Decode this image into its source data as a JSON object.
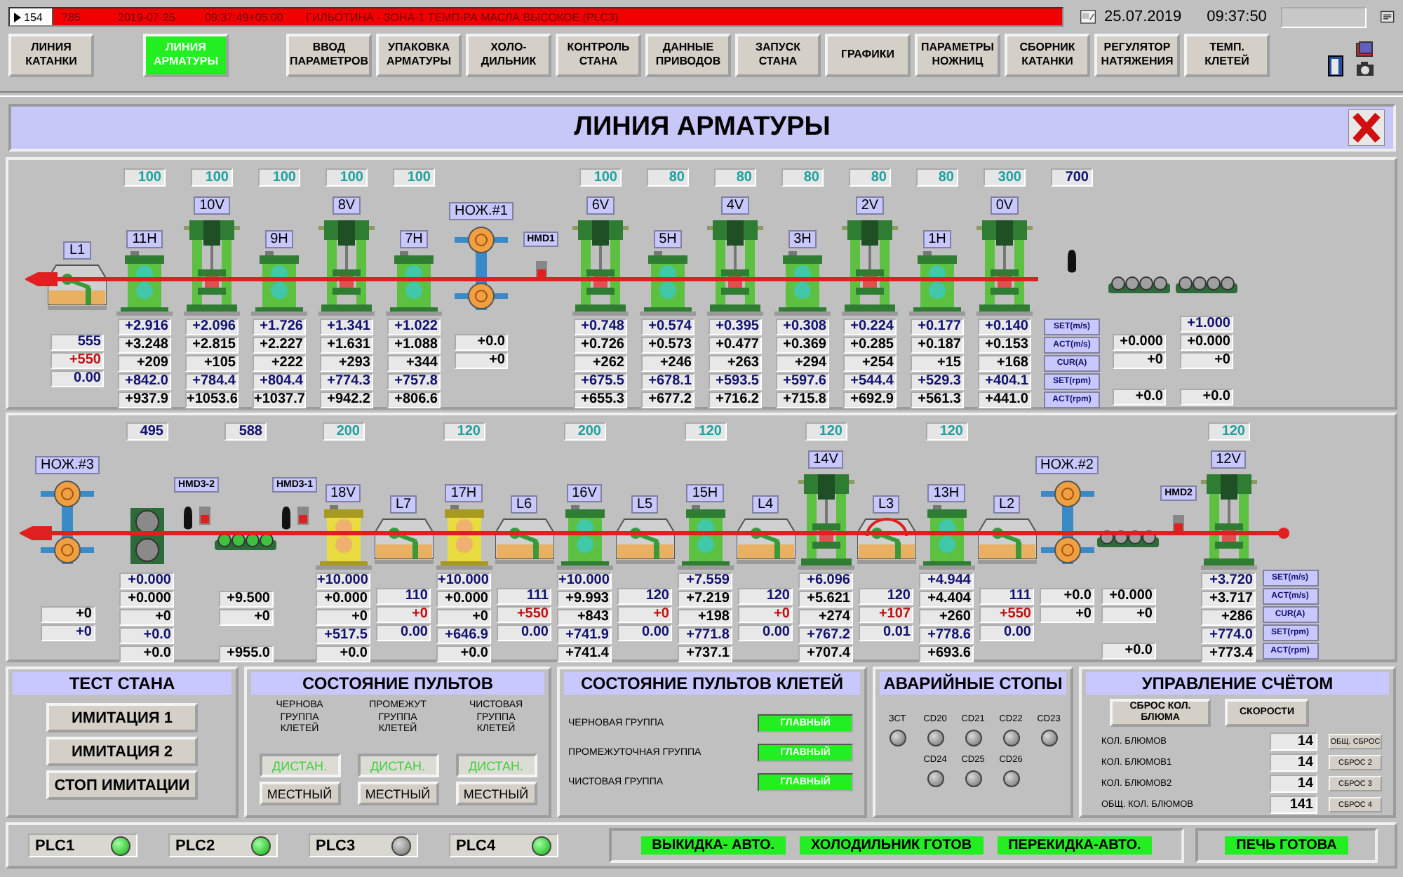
{
  "alarm_bar": {
    "count": "154",
    "code": "785",
    "date": "2019-07-25",
    "time": "09:37:49+05:00",
    "message": "ГИЛЬОТИНА - ЗОНА-1 ТЕМП-РА МАСЛА ВЫСОКОЕ (PLC3)"
  },
  "clock": {
    "date": "25.07.2019",
    "time": "09:37:50"
  },
  "nav": [
    {
      "label": "ЛИНИЯ\nКАТАНКИ",
      "selected": false
    },
    {
      "label": "ЛИНИЯ\nАРМАТУРЫ",
      "selected": true
    },
    {
      "label": "ВВОД\nПАРАМЕТРОВ",
      "selected": false
    },
    {
      "label": "УПАКОВКА\nАРМАТУРЫ",
      "selected": false
    },
    {
      "label": "ХОЛО-\nДИЛЬНИК",
      "selected": false
    },
    {
      "label": "КОНТРОЛЬ\nСТАНА",
      "selected": false
    },
    {
      "label": "ДАННЫЕ\nПРИВОДОВ",
      "selected": false
    },
    {
      "label": "ЗАПУСК\nСТАНА",
      "selected": false
    },
    {
      "label": "ГРАФИКИ",
      "selected": false
    },
    {
      "label": "ПАРАМЕТРЫ\nНОЖНИЦ",
      "selected": false
    },
    {
      "label": "СБОРНИК\nКАТАНКИ",
      "selected": false
    },
    {
      "label": "РЕГУЛЯТОР\nНАТЯЖЕНИЯ",
      "selected": false
    },
    {
      "label": "ТЕМП.\nКЛЕТЕЙ",
      "selected": false
    }
  ],
  "title": "ЛИНИЯ АРМАТУРЫ",
  "upper_line": {
    "columns": [
      {
        "kind": "looper",
        "label": "L1",
        "raised": false,
        "readings": {
          "act_speed": "555",
          "current": "+550",
          "set_rpm": "0.00"
        }
      },
      {
        "kind": "hstand",
        "label": "11H",
        "setpoint": "100",
        "running": true,
        "readings": {
          "set_speed": "+2.916",
          "act_speed": "+3.248",
          "current": "+209",
          "set_rpm": "+842.0",
          "act_rpm": "+937.9"
        }
      },
      {
        "kind": "vstand",
        "label": "10V",
        "setpoint": "100",
        "running": true,
        "readings": {
          "set_speed": "+2.096",
          "act_speed": "+2.815",
          "current": "+105",
          "set_rpm": "+784.4",
          "act_rpm": "+1053.6"
        }
      },
      {
        "kind": "hstand",
        "label": "9H",
        "setpoint": "100",
        "running": true,
        "readings": {
          "set_speed": "+1.726",
          "act_speed": "+2.227",
          "current": "+222",
          "set_rpm": "+804.4",
          "act_rpm": "+1037.7"
        }
      },
      {
        "kind": "vstand",
        "label": "8V",
        "setpoint": "100",
        "running": true,
        "readings": {
          "set_speed": "+1.341",
          "act_speed": "+1.631",
          "current": "+293",
          "set_rpm": "+774.3",
          "act_rpm": "+942.2"
        }
      },
      {
        "kind": "hstand",
        "label": "7H",
        "setpoint": "100",
        "running": true,
        "readings": {
          "set_speed": "+1.022",
          "act_speed": "+1.088",
          "current": "+344",
          "set_rpm": "+757.8",
          "act_rpm": "+806.6"
        }
      },
      {
        "kind": "shear",
        "label": "НОЖ.#1",
        "readings": {
          "act_speed": "+0.0",
          "current": "+0"
        }
      },
      {
        "kind": "sensor",
        "label": "HMD1"
      },
      {
        "kind": "vstand",
        "label": "6V",
        "setpoint": "100",
        "running": true,
        "readings": {
          "set_speed": "+0.748",
          "act_speed": "+0.726",
          "current": "+262",
          "set_rpm": "+675.5",
          "act_rpm": "+655.3"
        }
      },
      {
        "kind": "hstand",
        "label": "5H",
        "setpoint": "80",
        "running": true,
        "readings": {
          "set_speed": "+0.574",
          "act_speed": "+0.573",
          "current": "+246",
          "set_rpm": "+678.1",
          "act_rpm": "+677.2"
        }
      },
      {
        "kind": "vstand",
        "label": "4V",
        "setpoint": "80",
        "running": true,
        "readings": {
          "set_speed": "+0.395",
          "act_speed": "+0.477",
          "current": "+263",
          "set_rpm": "+593.5",
          "act_rpm": "+716.2"
        }
      },
      {
        "kind": "hstand",
        "label": "3H",
        "setpoint": "80",
        "running": true,
        "readings": {
          "set_speed": "+0.308",
          "act_speed": "+0.369",
          "current": "+294",
          "set_rpm": "+597.6",
          "act_rpm": "+715.8"
        }
      },
      {
        "kind": "vstand",
        "label": "2V",
        "setpoint": "80",
        "running": true,
        "readings": {
          "set_speed": "+0.224",
          "act_speed": "+0.285",
          "current": "+254",
          "set_rpm": "+544.4",
          "act_rpm": "+692.9"
        }
      },
      {
        "kind": "hstand",
        "label": "1H",
        "setpoint": "80",
        "running": true,
        "readings": {
          "set_speed": "+0.177",
          "act_speed": "+0.187",
          "current": "+15",
          "set_rpm": "+529.3",
          "act_rpm": "+561.3"
        }
      },
      {
        "kind": "vstand",
        "label": "0V",
        "setpoint": "300",
        "running": true,
        "readings": {
          "set_speed": "+0.140",
          "act_speed": "+0.153",
          "current": "+168",
          "set_rpm": "+404.1",
          "act_rpm": "+441.0"
        }
      },
      {
        "kind": "probe",
        "setpoint": "700",
        "row_labels": [
          "SET(m/s)",
          "ACT(m/s)",
          "CUR(A)",
          "SET(rpm)",
          "ACT(rpm)"
        ]
      },
      {
        "kind": "rollers",
        "active": false,
        "readings": {
          "act_speed": "+0.000",
          "current": "+0",
          "act_rpm": "+0.0"
        }
      },
      {
        "kind": "rollers",
        "active": false,
        "readings": {
          "set_speed": "+1.000",
          "act_speed": "+0.000",
          "current": "+0",
          "act_rpm": "+0.0"
        }
      }
    ]
  },
  "lower_line": {
    "columns": [
      {
        "kind": "shear",
        "label": "НОЖ.#3",
        "readings": {
          "current": "+0",
          "set_rpm": "+0"
        }
      },
      {
        "kind": "pinch",
        "setpoint": "495",
        "readings": {
          "set_speed": "+0.000",
          "act_speed": "+0.000",
          "current": "+0",
          "set_rpm": "+0.0",
          "act_rpm": "+0.0"
        }
      },
      {
        "kind": "probe_sensor",
        "label": "HMD3-2"
      },
      {
        "kind": "rollers",
        "setpoint": "588",
        "active": true,
        "readings": {
          "act_speed": "+9.500",
          "current": "+0",
          "act_rpm": "+955.0"
        }
      },
      {
        "kind": "probe_sensor",
        "label": "HMD3-1"
      },
      {
        "kind": "hstand",
        "label": "18V",
        "setpoint": "200",
        "running": false,
        "readings": {
          "set_speed": "+10.000",
          "act_speed": "+0.000",
          "current": "+0",
          "set_rpm": "+517.5",
          "act_rpm": "+0.0"
        }
      },
      {
        "kind": "looper",
        "label": "L7",
        "raised": false,
        "readings": {
          "act_speed": "110",
          "current": "+0",
          "set_rpm": "0.00"
        }
      },
      {
        "kind": "hstand",
        "label": "17H",
        "setpoint": "120",
        "running": false,
        "readings": {
          "set_speed": "+10.000",
          "act_speed": "+0.000",
          "current": "+0",
          "set_rpm": "+646.9",
          "act_rpm": "+0.0"
        }
      },
      {
        "kind": "looper",
        "label": "L6",
        "raised": false,
        "readings": {
          "act_speed": "111",
          "current": "+550",
          "set_rpm": "0.00"
        }
      },
      {
        "kind": "hstand",
        "label": "16V",
        "setpoint": "200",
        "running": true,
        "readings": {
          "set_speed": "+10.000",
          "act_speed": "+9.993",
          "current": "+843",
          "set_rpm": "+741.9",
          "act_rpm": "+741.4"
        }
      },
      {
        "kind": "looper",
        "label": "L5",
        "raised": false,
        "readings": {
          "act_speed": "120",
          "current": "+0",
          "set_rpm": "0.00"
        }
      },
      {
        "kind": "hstand",
        "label": "15H",
        "setpoint": "120",
        "running": true,
        "readings": {
          "set_speed": "+7.559",
          "act_speed": "+7.219",
          "current": "+198",
          "set_rpm": "+771.8",
          "act_rpm": "+737.1"
        }
      },
      {
        "kind": "looper",
        "label": "L4",
        "raised": false,
        "readings": {
          "act_speed": "120",
          "current": "+0",
          "set_rpm": "0.00"
        }
      },
      {
        "kind": "vstand",
        "label": "14V",
        "setpoint": "120",
        "running": true,
        "readings": {
          "set_speed": "+6.096",
          "act_speed": "+5.621",
          "current": "+274",
          "set_rpm": "+767.2",
          "act_rpm": "+707.4"
        }
      },
      {
        "kind": "looper",
        "label": "L3",
        "raised": true,
        "readings": {
          "act_speed": "120",
          "current": "+107",
          "set_rpm": "0.01"
        }
      },
      {
        "kind": "hstand",
        "label": "13H",
        "setpoint": "120",
        "running": true,
        "readings": {
          "set_speed": "+4.944",
          "act_speed": "+4.404",
          "current": "+260",
          "set_rpm": "+778.6",
          "act_rpm": "+693.6"
        }
      },
      {
        "kind": "looper",
        "label": "L2",
        "raised": false,
        "readings": {
          "act_speed": "111",
          "current": "+550",
          "set_rpm": "0.00"
        }
      },
      {
        "kind": "shear",
        "label": "НОЖ.#2",
        "readings": {
          "act_speed": "+0.0",
          "current": "+0"
        }
      },
      {
        "kind": "rollers",
        "active": false,
        "readings": {
          "act_speed": "+0.000",
          "current": "+0",
          "act_rpm": "+0.0"
        }
      },
      {
        "kind": "sensor",
        "label": "HMD2"
      },
      {
        "kind": "vstand",
        "label": "12V",
        "setpoint": "120",
        "running": true,
        "readings": {
          "set_speed": "+3.720",
          "act_speed": "+3.717",
          "current": "+286",
          "set_rpm": "+774.0",
          "act_rpm": "+773.4"
        }
      },
      {
        "kind": "legend",
        "row_labels": [
          "SET(m/s)",
          "ACT(m/s)",
          "CUR(A)",
          "SET(rpm)",
          "ACT(rpm)"
        ]
      }
    ]
  },
  "test_panel": {
    "title": "ТЕСТ СТАНА",
    "buttons": [
      "ИМИТАЦИЯ 1",
      "ИМИТАЦИЯ 2",
      "СТОП ИМИТАЦИИ"
    ]
  },
  "desks": {
    "title": "СОСТОЯНИЕ ПУЛЬТОВ",
    "groups": [
      {
        "name": "ЧЕРНОВА\nГРУППА\nКЛЕТЕЙ",
        "modes": [
          {
            "label": "ДИСТАН.",
            "selected": true
          },
          {
            "label": "МЕСТНЫЙ",
            "selected": false
          }
        ]
      },
      {
        "name": "ПРОМЕЖУТ\nГРУППА\nКЛЕТЕЙ",
        "modes": [
          {
            "label": "ДИСТАН.",
            "selected": true
          },
          {
            "label": "МЕСТНЫЙ",
            "selected": false
          }
        ]
      },
      {
        "name": "ЧИСТОВАЯ\nГРУППА\nКЛЕТЕЙ",
        "modes": [
          {
            "label": "ДИСТАН.",
            "selected": true
          },
          {
            "label": "МЕСТНЫЙ",
            "selected": false
          }
        ]
      }
    ]
  },
  "stand_desks": {
    "title": "СОСТОЯНИЕ ПУЛЬТОВ КЛЕТЕЙ",
    "rows": [
      {
        "name": "ЧЕРНОВАЯ ГРУППА",
        "status": "ГЛАВНЫЙ"
      },
      {
        "name": "ПРОМЕЖУТОЧНАЯ ГРУППА",
        "status": "ГЛАВНЫЙ"
      },
      {
        "name": "ЧИСТОВАЯ ГРУППА",
        "status": "ГЛАВНЫЙ"
      }
    ]
  },
  "emergency_stops": {
    "title": "АВАРИЙНЫЕ СТОПЫ",
    "rows": [
      {
        "stops": [
          {
            "label": "ЗСТ",
            "on": false
          },
          {
            "label": "CD20",
            "on": false
          },
          {
            "label": "CD21",
            "on": false
          },
          {
            "label": "CD22",
            "on": false
          },
          {
            "label": "CD23",
            "on": false
          }
        ]
      },
      {
        "stops": [
          {
            "label": "CD24",
            "on": false
          },
          {
            "label": "CD25",
            "on": false
          },
          {
            "label": "CD26",
            "on": false
          }
        ]
      }
    ]
  },
  "counting": {
    "title": "УПРАВЛЕНИЕ СЧЁТОМ",
    "buttons": [
      "СБРОС КОЛ.\nБЛЮМА",
      "СКОРОСТИ"
    ],
    "counters": [
      {
        "name": "КОЛ. БЛЮМОВ",
        "value": "14",
        "button": "ОБЩ. СБРОС"
      },
      {
        "name": "КОЛ. БЛЮМОВ1",
        "value": "14",
        "button": "СБРОС 2"
      },
      {
        "name": "КОЛ. БЛЮМОВ2",
        "value": "14",
        "button": "СБРОС 3"
      },
      {
        "name": "ОБЩ. КОЛ. БЛЮМОВ",
        "value": "141",
        "button": "СБРОС 4"
      }
    ]
  },
  "status_bar": {
    "plcs": [
      {
        "name": "PLC1",
        "on": true
      },
      {
        "name": "PLC2",
        "on": true
      },
      {
        "name": "PLC3",
        "on": false
      },
      {
        "name": "PLC4",
        "on": true
      }
    ],
    "messages": [
      "ВЫКИДКА- АВТО.",
      "ХОЛОДИЛЬНИК ГОТОВ",
      "ПЕРЕКИДКА-АВТО."
    ],
    "furnace": "ПЕЧЬ ГОТОВА"
  }
}
